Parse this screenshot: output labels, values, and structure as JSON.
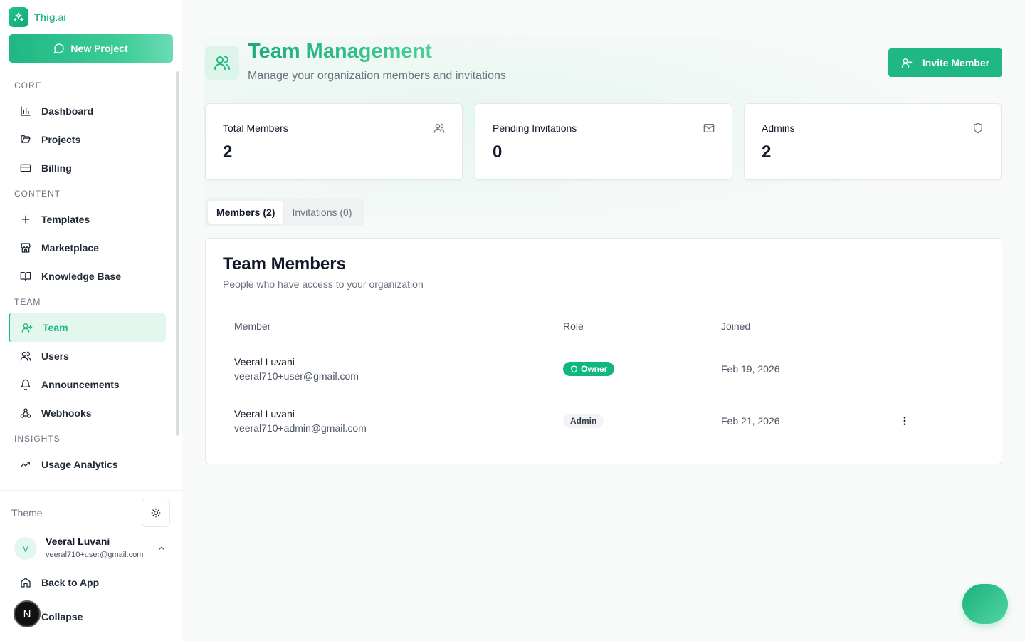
{
  "brand": {
    "name": "Thig",
    "suffix": ".ai"
  },
  "sidebar": {
    "new_project": "New Project",
    "sections": {
      "core": "CORE",
      "content": "CONTENT",
      "team": "TEAM",
      "insights": "INSIGHTS"
    },
    "items": {
      "dashboard": "Dashboard",
      "projects": "Projects",
      "billing": "Billing",
      "templates": "Templates",
      "marketplace": "Marketplace",
      "knowledge_base": "Knowledge Base",
      "team": "Team",
      "users": "Users",
      "announcements": "Announcements",
      "webhooks": "Webhooks",
      "usage_analytics": "Usage Analytics"
    },
    "active_item": "Team",
    "theme_label": "Theme",
    "user": {
      "initial": "V",
      "name": "Veeral Luvani",
      "email": "veeral710+user@gmail.com"
    },
    "back_to_app": "Back to App",
    "collapse": "Collapse",
    "dev_badge": "N"
  },
  "header": {
    "title": "Team Management",
    "subtitle": "Manage your organization members and invitations",
    "invite_button": "Invite Member"
  },
  "stats": {
    "total_members": {
      "label": "Total Members",
      "value": "2",
      "icon": "users-icon"
    },
    "pending_invitations": {
      "label": "Pending Invitations",
      "value": "0",
      "icon": "mail-icon"
    },
    "admins": {
      "label": "Admins",
      "value": "2",
      "icon": "shield-icon"
    }
  },
  "tabs": {
    "members": "Members (2)",
    "invitations": "Invitations (0)",
    "active": "Members (2)"
  },
  "members_panel": {
    "title": "Team Members",
    "subtitle": "People who have access to your organization",
    "columns": {
      "member": "Member",
      "role": "Role",
      "joined": "Joined"
    },
    "rows": [
      {
        "name": "Veeral Luvani",
        "email": "veeral710+user@gmail.com",
        "role": "Owner",
        "joined": "Feb 19, 2026"
      },
      {
        "name": "Veeral Luvani",
        "email": "veeral710+admin@gmail.com",
        "role": "Admin",
        "joined": "Feb 21, 2026"
      }
    ]
  },
  "colors": {
    "accent": "#1fb783",
    "accent_light": "#e4f7ef",
    "owner_badge": "#10b77f"
  }
}
